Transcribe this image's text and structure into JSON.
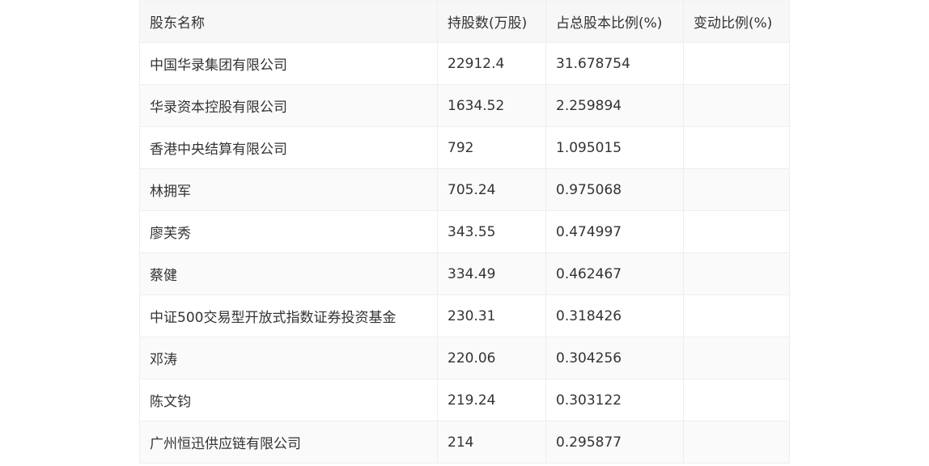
{
  "table": {
    "headers": [
      "股东名称",
      "持股数(万股)",
      "占总股本比例(%)",
      "变动比例(%)"
    ],
    "rows": [
      [
        "中国华录集团有限公司",
        "22912.4",
        "31.678754",
        ""
      ],
      [
        "华录资本控股有限公司",
        "1634.52",
        "2.259894",
        ""
      ],
      [
        "香港中央结算有限公司",
        "792",
        "1.095015",
        ""
      ],
      [
        "林拥军",
        "705.24",
        "0.975068",
        ""
      ],
      [
        "廖芙秀",
        "343.55",
        "0.474997",
        ""
      ],
      [
        "蔡健",
        "334.49",
        "0.462467",
        ""
      ],
      [
        "中证500交易型开放式指数证券投资基金",
        "230.31",
        "0.318426",
        ""
      ],
      [
        "邓涛",
        "220.06",
        "0.304256",
        ""
      ],
      [
        "陈文钧",
        "219.24",
        "0.303122",
        ""
      ],
      [
        "广州恒迅供应链有限公司",
        "214",
        "0.295877",
        ""
      ]
    ]
  }
}
